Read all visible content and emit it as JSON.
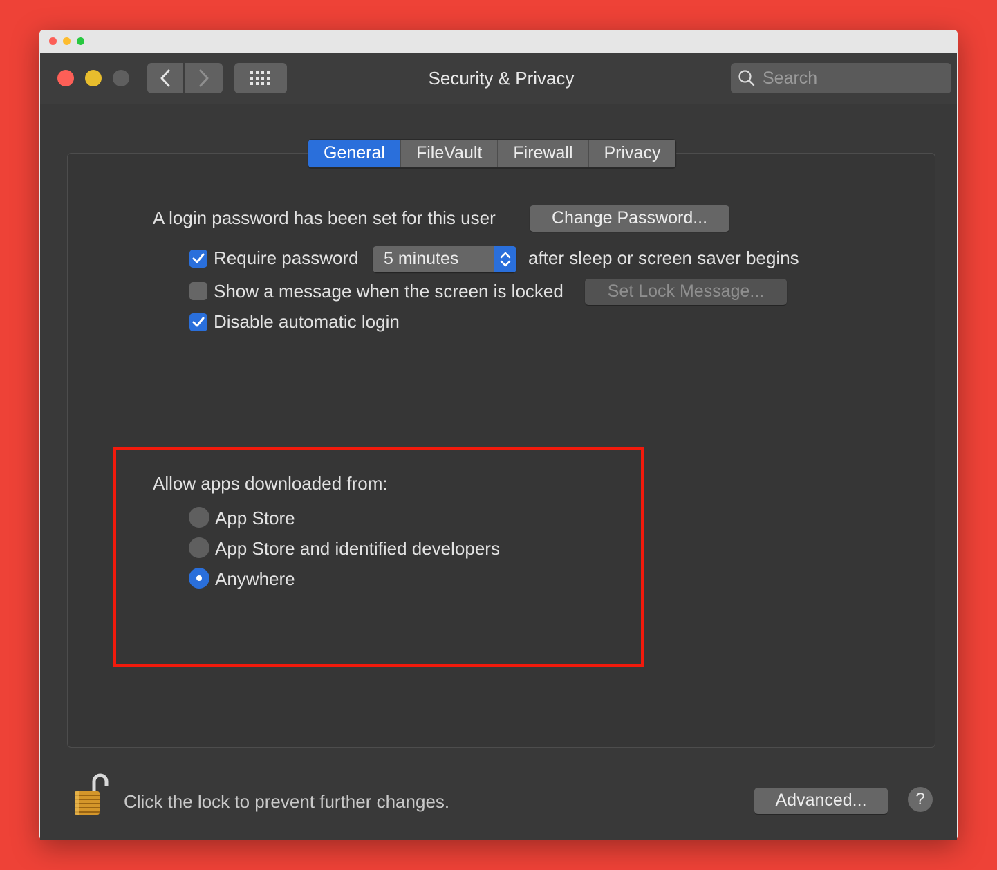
{
  "window": {
    "title": "Security & Privacy",
    "search_placeholder": "Search"
  },
  "tabs": [
    {
      "label": "General",
      "active": true
    },
    {
      "label": "FileVault",
      "active": false
    },
    {
      "label": "Firewall",
      "active": false
    },
    {
      "label": "Privacy",
      "active": false
    }
  ],
  "general": {
    "login_text": "A login password has been set for this user",
    "change_password_label": "Change Password...",
    "require_password": {
      "label": "Require password",
      "checked": true
    },
    "require_interval": "5 minutes",
    "after_sleep_text": "after sleep or screen saver begins",
    "show_message": {
      "label": "Show a message when the screen is locked",
      "checked": false
    },
    "set_lock_message_label": "Set Lock Message...",
    "disable_auto_login": {
      "label": "Disable automatic login",
      "checked": true
    }
  },
  "allow_apps": {
    "heading": "Allow apps downloaded from:",
    "options": [
      {
        "label": "App Store",
        "selected": false
      },
      {
        "label": "App Store and identified developers",
        "selected": false
      },
      {
        "label": "Anywhere",
        "selected": true
      }
    ]
  },
  "footer": {
    "lock_text": "Click the lock to prevent further changes.",
    "advanced_label": "Advanced...",
    "help_label": "?"
  },
  "colors": {
    "background": "#ee4237",
    "accent": "#2a6fdb",
    "highlight": "#f21a0c"
  }
}
